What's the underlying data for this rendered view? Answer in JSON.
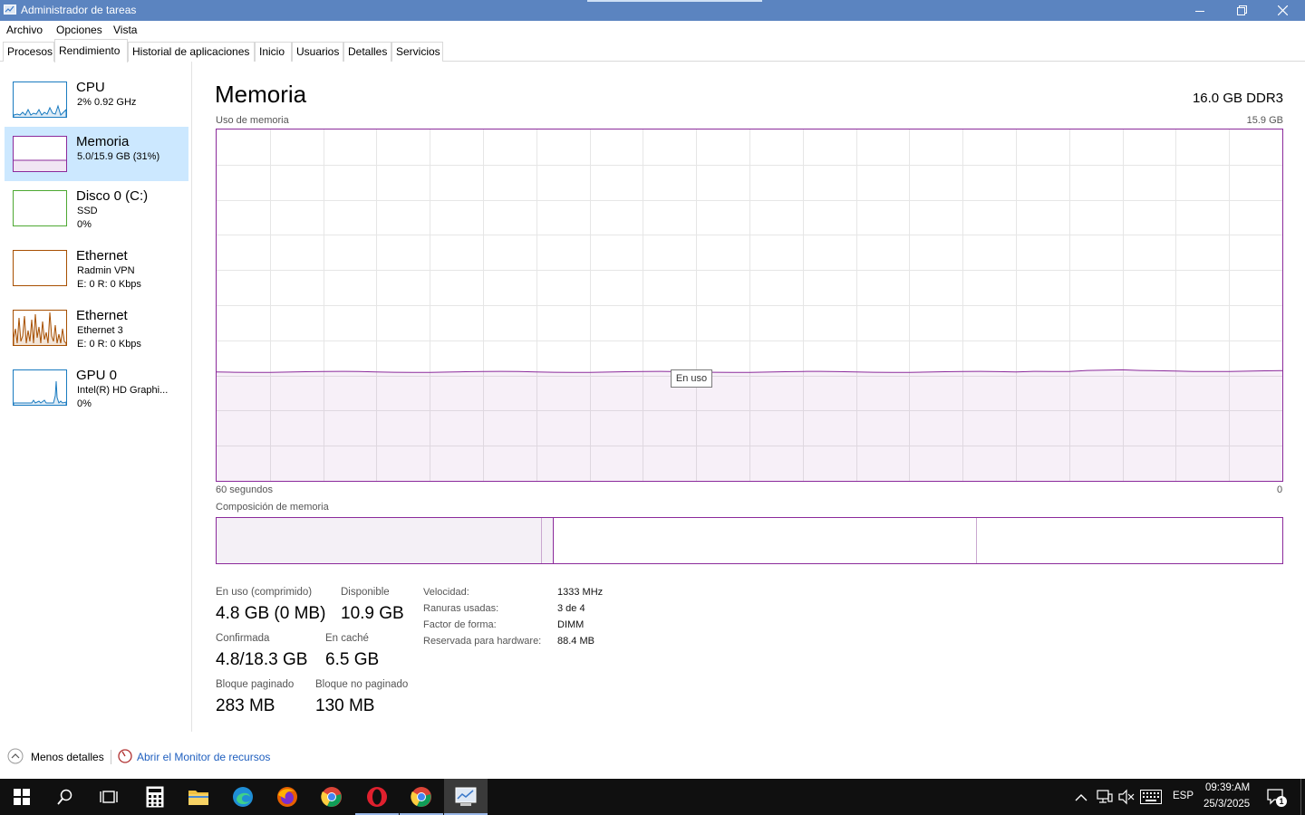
{
  "window": {
    "title": "Administrador de tareas"
  },
  "menu": {
    "items": [
      "Archivo",
      "Opciones",
      "Vista"
    ]
  },
  "tabs": [
    "Procesos",
    "Rendimiento",
    "Historial de aplicaciones",
    "Inicio",
    "Usuarios",
    "Detalles",
    "Servicios"
  ],
  "active_tab": "Rendimiento",
  "sidebar": {
    "items": [
      {
        "title": "CPU",
        "line1": "2% 0.92 GHz",
        "line2": "",
        "color": "#1a7bc0"
      },
      {
        "title": "Memoria",
        "line1": "5.0/15.9 GB (31%)",
        "line2": "",
        "color": "#8b2a9b"
      },
      {
        "title": "Disco 0 (C:)",
        "line1": "SSD",
        "line2": "0%",
        "color": "#4da832"
      },
      {
        "title": "Ethernet",
        "line1": "Radmin VPN",
        "line2": "E: 0 R: 0 Kbps",
        "color": "#a74f01"
      },
      {
        "title": "Ethernet",
        "line1": "Ethernet 3",
        "line2": "E: 0 R: 0 Kbps",
        "color": "#a74f01"
      },
      {
        "title": "GPU 0",
        "line1": "Intel(R) HD Graphi...",
        "line2": "0%",
        "color": "#1a7bc0"
      }
    ]
  },
  "main": {
    "title": "Memoria",
    "spec": "16.0 GB DDR3",
    "usage_label": "Uso de memoria",
    "usage_max": "15.9 GB",
    "time_left": "60 segundos",
    "time_right": "0",
    "tooltip": "En uso",
    "composition_label": "Composición de memoria",
    "usage_fraction": 0.31
  },
  "stats": {
    "in_use_label": "En uso (comprimido)",
    "in_use_value": "4.8 GB (0 MB)",
    "available_label": "Disponible",
    "available_value": "10.9 GB",
    "committed_label": "Confirmada",
    "committed_value": "4.8/18.3 GB",
    "cached_label": "En caché",
    "cached_value": "6.5 GB",
    "paged_label": "Bloque paginado",
    "paged_value": "283 MB",
    "nonpaged_label": "Bloque no paginado",
    "nonpaged_value": "130 MB"
  },
  "info": [
    {
      "label": "Velocidad:",
      "value": "1333 MHz"
    },
    {
      "label": "Ranuras usadas:",
      "value": "3 de 4"
    },
    {
      "label": "Factor de forma:",
      "value": "DIMM"
    },
    {
      "label": "Reservada para hardware:",
      "value": "88.4 MB"
    }
  ],
  "footer": {
    "less_details": "Menos detalles",
    "open_monitor": "Abrir el Monitor de recursos"
  },
  "taskbar": {
    "language": "ESP",
    "time": "09:39:AM",
    "date": "25/3/2025",
    "notification_count": "1"
  },
  "colors": {
    "memory": "#8b2a9b",
    "titlebar": "#5b84c0",
    "selected": "#cce8ff"
  }
}
